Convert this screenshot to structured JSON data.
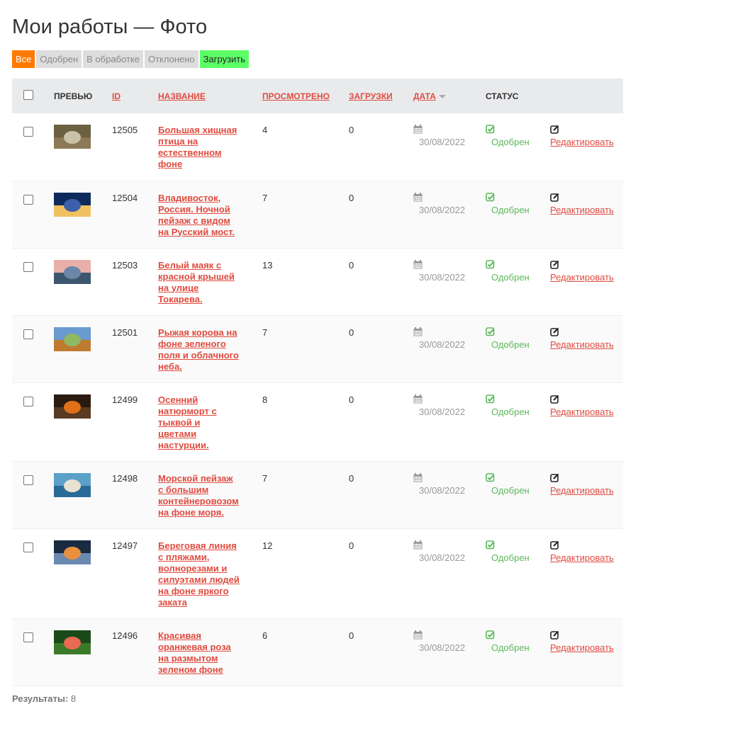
{
  "page_title": "Мои работы — Фото",
  "filters": [
    {
      "label": "Все",
      "state": "active"
    },
    {
      "label": "Одобрен",
      "state": "normal"
    },
    {
      "label": "В обработке",
      "state": "normal"
    },
    {
      "label": "Отклонено",
      "state": "normal"
    },
    {
      "label": "Загрузить",
      "state": "upload"
    }
  ],
  "columns": {
    "preview": "ПРЕВЬЮ",
    "id": "ID",
    "title": "НАЗВАНИЕ",
    "views": "ПРОСМОТРЕНО",
    "downloads": "ЗАГРУЗКИ",
    "date": "ДАТА",
    "status": "СТАТУС"
  },
  "rows": [
    {
      "id": "12505",
      "title_lines": [
        "Большая хищная",
        "птица на",
        "естественном",
        "фоне"
      ],
      "views": "4",
      "downloads": "0",
      "date": "30/08/2022",
      "status": "Одобрен",
      "action": "Редактировать",
      "thumb": [
        "#6b6040",
        "#c9c1a8",
        "#8b7a55"
      ]
    },
    {
      "id": "12504",
      "title_lines": [
        "Владивосток,",
        "Россия. Ночной",
        "пейзаж с видом",
        "на Русский мост."
      ],
      "views": "7",
      "downloads": "0",
      "date": "30/08/2022",
      "status": "Одобрен",
      "action": "Редактировать",
      "thumb": [
        "#0e2a5c",
        "#3b5fa8",
        "#f0c060"
      ]
    },
    {
      "id": "12503",
      "title_lines": [
        "Белый маяк с",
        "красной крышей",
        "на улице",
        "Токарева."
      ],
      "views": "13",
      "downloads": "0",
      "date": "30/08/2022",
      "status": "Одобрен",
      "action": "Редактировать",
      "thumb": [
        "#e8b0a8",
        "#6a87a8",
        "#3d556e"
      ]
    },
    {
      "id": "12501",
      "title_lines": [
        "Рыжая корова на",
        "фоне зеленого",
        "поля и облачного",
        "неба."
      ],
      "views": "7",
      "downloads": "0",
      "date": "30/08/2022",
      "status": "Одобрен",
      "action": "Редактировать",
      "thumb": [
        "#6a9ad0",
        "#8fb860",
        "#c07a30"
      ]
    },
    {
      "id": "12499",
      "title_lines": [
        "Осенний",
        "натюрморт с",
        "тыквой и",
        "цветами",
        "настурции."
      ],
      "views": "8",
      "downloads": "0",
      "date": "30/08/2022",
      "status": "Одобрен",
      "action": "Редактировать",
      "thumb": [
        "#2a1a10",
        "#e0701a",
        "#5a3a20"
      ]
    },
    {
      "id": "12498",
      "title_lines": [
        "Морской пейзаж",
        "с большим",
        "контейнеровозом",
        "на фоне моря."
      ],
      "views": "7",
      "downloads": "0",
      "date": "30/08/2022",
      "status": "Одобрен",
      "action": "Редактировать",
      "thumb": [
        "#5aa0c8",
        "#e8e0d0",
        "#2a6a98"
      ]
    },
    {
      "id": "12497",
      "title_lines": [
        "Береговая линия",
        "с пляжами,",
        "волнорезами и",
        "силуэтами людей",
        "на фоне яркого",
        "заката"
      ],
      "views": "12",
      "downloads": "0",
      "date": "30/08/2022",
      "status": "Одобрен",
      "action": "Редактировать",
      "thumb": [
        "#1a2a40",
        "#e89040",
        "#6a8ab0"
      ]
    },
    {
      "id": "12496",
      "title_lines": [
        "Красивая",
        "оранжевая роза",
        "на размытом",
        "зеленом фоне"
      ],
      "views": "6",
      "downloads": "0",
      "date": "30/08/2022",
      "status": "Одобрен",
      "action": "Редактировать",
      "thumb": [
        "#1a4a1a",
        "#e86a50",
        "#3a7a2a"
      ]
    }
  ],
  "results_label": "Результаты:",
  "results_count": "8",
  "colors": {
    "accent": "#ff7a00",
    "link": "#e04b3f",
    "approved": "#5cb85c",
    "upload": "#5cff66"
  }
}
